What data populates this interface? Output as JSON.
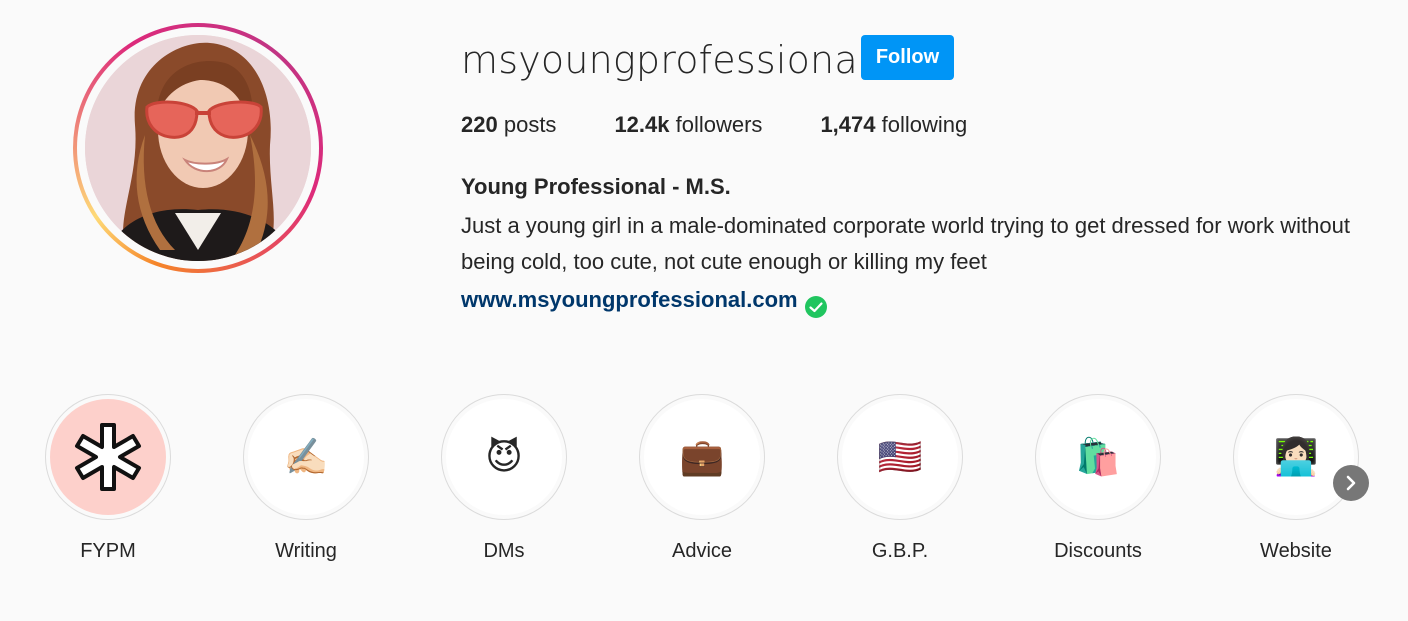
{
  "profile": {
    "username": "msyoungprofessional",
    "follow_label": "Follow",
    "full_name": "Young Professional - M.S.",
    "bio": "Just a young girl in a male-dominated corporate world trying to get dressed for work without being cold, too cute, not cute enough or killing my feet",
    "website": "www.msyoungprofessional.com",
    "verified_icon": "green-check-circle-icon"
  },
  "stats": {
    "posts_count": "220",
    "posts_label": "posts",
    "followers_count": "12.4k",
    "followers_label": "followers",
    "following_count": "1,474",
    "following_label": "following"
  },
  "highlights": [
    {
      "label": "FYPM",
      "emoji": "✱",
      "icon": "asterisk-icon"
    },
    {
      "label": "Writing",
      "emoji": "✍🏻",
      "icon": "writing-hand-icon"
    },
    {
      "label": "DMs",
      "emoji": "😈",
      "icon": "smiling-devil-icon"
    },
    {
      "label": "Advice",
      "emoji": "💼",
      "icon": "briefcase-icon"
    },
    {
      "label": "G.B.P.",
      "emoji": "🇺🇸",
      "icon": "us-flag-icon"
    },
    {
      "label": "Discounts",
      "emoji": "🛍️",
      "icon": "shopping-bags-icon"
    },
    {
      "label": "Website",
      "emoji": "👩🏻‍💻",
      "icon": "woman-technologist-icon"
    }
  ],
  "colors": {
    "follow_button": "#0095f6",
    "link": "#00376b",
    "verified": "#20c55f",
    "fypm_bg": "#fdd0cb"
  }
}
